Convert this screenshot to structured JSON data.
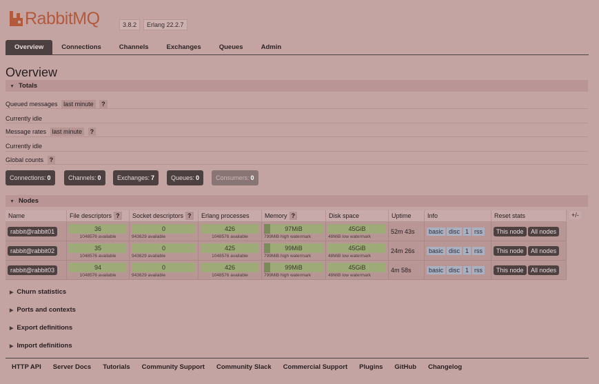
{
  "header": {
    "logo_text": "RabbitMQ",
    "version": "3.8.2",
    "erlang": "Erlang 22.2.7"
  },
  "tabs": [
    {
      "label": "Overview",
      "active": true
    },
    {
      "label": "Connections"
    },
    {
      "label": "Channels"
    },
    {
      "label": "Exchanges"
    },
    {
      "label": "Queues"
    },
    {
      "label": "Admin"
    }
  ],
  "page_title": "Overview",
  "totals": {
    "section_label": "Totals",
    "queued_messages_label": "Queued messages",
    "queued_range": "last minute",
    "help": "?",
    "currently_idle_1": "Currently idle",
    "message_rates_label": "Message rates",
    "rates_range": "last minute",
    "currently_idle_2": "Currently idle",
    "global_counts_label": "Global counts"
  },
  "counts": [
    {
      "label": "Connections:",
      "value": "0"
    },
    {
      "label": "Channels:",
      "value": "0"
    },
    {
      "label": "Exchanges:",
      "value": "7"
    },
    {
      "label": "Queues:",
      "value": "0"
    },
    {
      "label": "Consumers:",
      "value": "0"
    }
  ],
  "nodes": {
    "section_label": "Nodes",
    "columns": [
      "Name",
      "File descriptors",
      "Socket descriptors",
      "Erlang processes",
      "Memory",
      "Disk space",
      "Uptime",
      "Info",
      "Reset stats"
    ],
    "plus_minus": "+/-",
    "rows": [
      {
        "name": "rabbit@rabbit01",
        "fd": "36",
        "fd_avail": "1048576 available",
        "sock": "0",
        "sock_avail": "943629 available",
        "proc": "426",
        "proc_avail": "1048576 available",
        "mem": "97MiB",
        "mem_wm": "799MiB high watermark",
        "disk": "45GiB",
        "disk_wm": "48MiB low watermark",
        "uptime": "52m 43s",
        "info": [
          "basic",
          "disc",
          "1",
          "rss"
        ],
        "this_node": "This node",
        "all_nodes": "All nodes"
      },
      {
        "name": "rabbit@rabbit02",
        "fd": "35",
        "fd_avail": "1048576 available",
        "sock": "0",
        "sock_avail": "943629 available",
        "proc": "425",
        "proc_avail": "1048576 available",
        "mem": "99MiB",
        "mem_wm": "799MiB high watermark",
        "disk": "45GiB",
        "disk_wm": "48MiB low watermark",
        "uptime": "24m 26s",
        "info": [
          "basic",
          "disc",
          "1",
          "rss"
        ],
        "this_node": "This node",
        "all_nodes": "All nodes"
      },
      {
        "name": "rabbit@rabbit03",
        "fd": "94",
        "fd_avail": "1048576 available",
        "sock": "0",
        "sock_avail": "943629 available",
        "proc": "426",
        "proc_avail": "1048576 available",
        "mem": "99MiB",
        "mem_wm": "799MiB high watermark",
        "disk": "45GiB",
        "disk_wm": "48MiB low watermark",
        "uptime": "4m 58s",
        "info": [
          "basic",
          "disc",
          "1",
          "rss"
        ],
        "this_node": "This node",
        "all_nodes": "All nodes"
      }
    ]
  },
  "collapsed_sections": [
    "Churn statistics",
    "Ports and contexts",
    "Export definitions",
    "Import definitions"
  ],
  "footer_links": [
    "HTTP API",
    "Server Docs",
    "Tutorials",
    "Community Support",
    "Community Slack",
    "Commercial Support",
    "Plugins",
    "GitHub",
    "Changelog"
  ]
}
